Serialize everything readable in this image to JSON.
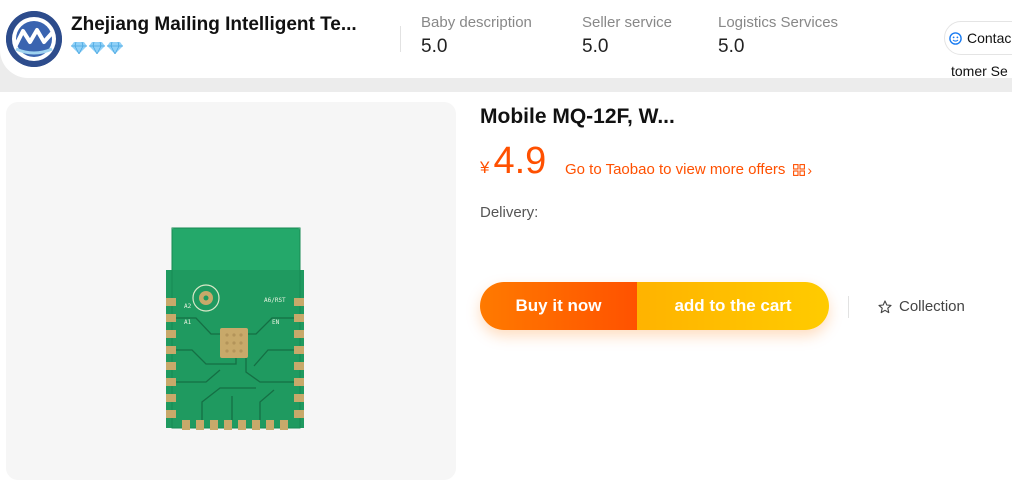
{
  "store": {
    "name": "Zhejiang Mailing Intelligent Te...",
    "logo_icon": "store-logo-icon",
    "rank_icon": "diamond-icon",
    "rank_count": 3
  },
  "ratings": [
    {
      "label": "Baby description",
      "value": "5.0"
    },
    {
      "label": "Seller service",
      "value": "5.0"
    },
    {
      "label": "Logistics Services",
      "value": "5.0"
    }
  ],
  "contact": {
    "label_line1": "Contac",
    "label_line2": "tomer Se",
    "icon": "smile-icon"
  },
  "product": {
    "title": "Mobile MQ-12F, W...",
    "currency": "¥",
    "price": "4.9",
    "offers_link": "Go to Taobao to view more offers",
    "delivery_label": "Delivery:"
  },
  "actions": {
    "buy_now": "Buy it now",
    "add_to_cart": "add to the cart",
    "collection": "Collection"
  },
  "colors": {
    "accent": "#ff5000",
    "buy_start": "#ff7a00",
    "buy_end": "#ff5200",
    "cart_start": "#ffb300",
    "cart_end": "#ffcb00",
    "pcb_green": "#1fa067",
    "logo_blue": "#2d4c8c"
  }
}
